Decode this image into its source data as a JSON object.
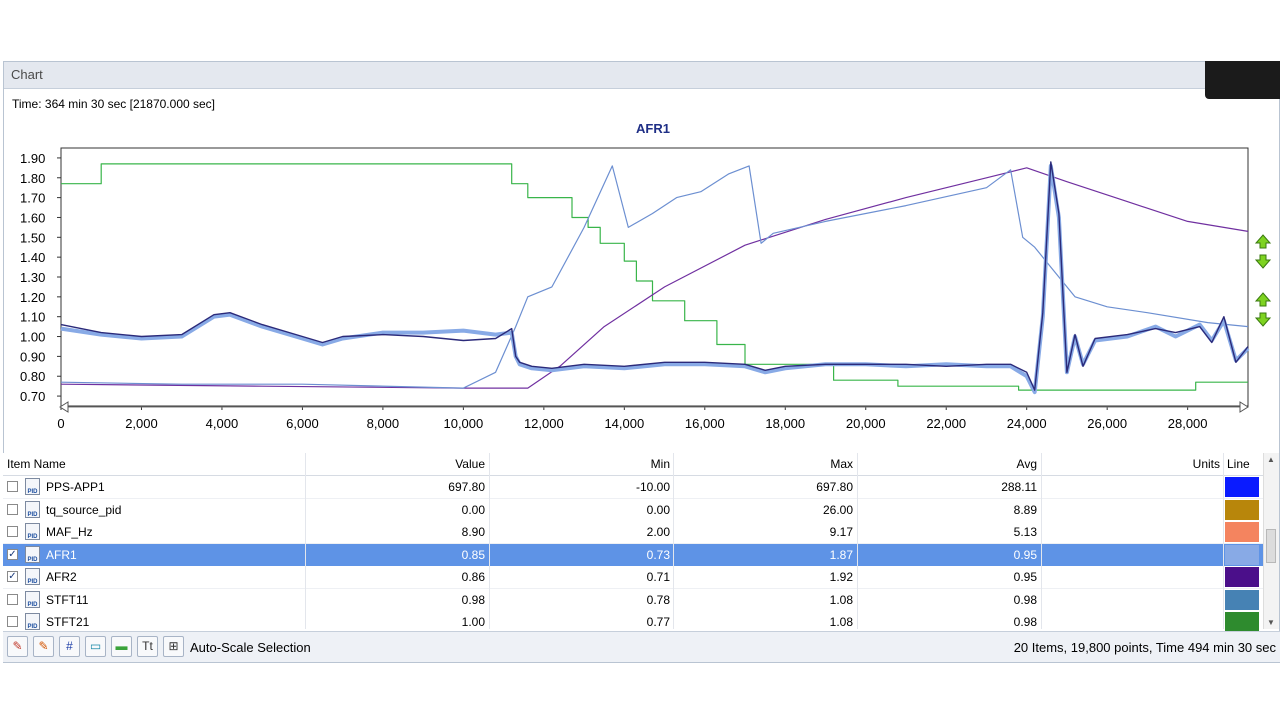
{
  "window": {
    "title": "Chart"
  },
  "time_label": "Time: 364 min 30 sec [21870.000 sec]",
  "chart_data": {
    "type": "line",
    "title": "AFR1",
    "xlim": [
      0,
      29500
    ],
    "ylim": [
      0.65,
      1.95
    ],
    "x_ticks": [
      0,
      2000,
      4000,
      6000,
      8000,
      10000,
      12000,
      14000,
      16000,
      18000,
      20000,
      22000,
      24000,
      26000,
      28000
    ],
    "x_tick_labels": [
      "0",
      "2,000",
      "4,000",
      "6,000",
      "8,000",
      "10,000",
      "12,000",
      "14,000",
      "16,000",
      "18,000",
      "20,000",
      "22,000",
      "24,000",
      "26,000",
      "28,000"
    ],
    "y_ticks": [
      0.7,
      0.8,
      0.9,
      1.0,
      1.1,
      1.2,
      1.3,
      1.4,
      1.5,
      1.6,
      1.7,
      1.8,
      1.9
    ],
    "y_tick_labels": [
      "0.70",
      "0.80",
      "0.90",
      "1.00",
      "1.10",
      "1.20",
      "1.30",
      "1.40",
      "1.50",
      "1.60",
      "1.70",
      "1.80",
      "1.90"
    ],
    "series": [
      {
        "color": "#39b54a",
        "width": 1.2,
        "step": true,
        "x": [
          0,
          1000,
          11200,
          11600,
          12700,
          13100,
          13400,
          14000,
          14300,
          14700,
          15500,
          16300,
          17000,
          19200,
          20800,
          23800,
          28000,
          28200,
          29500
        ],
        "y": [
          1.77,
          1.87,
          1.77,
          1.7,
          1.6,
          1.55,
          1.47,
          1.38,
          1.28,
          1.18,
          1.08,
          0.96,
          0.86,
          0.78,
          0.75,
          0.73,
          0.73,
          0.77,
          0.77
        ]
      },
      {
        "color": "#7030a0",
        "width": 1.2,
        "x": [
          0,
          5000,
          10000,
          11600,
          12400,
          13500,
          15000,
          17000,
          19000,
          21000,
          23000,
          24000,
          25000,
          26500,
          28000,
          29500
        ],
        "y": [
          0.76,
          0.75,
          0.74,
          0.74,
          0.85,
          1.05,
          1.25,
          1.46,
          1.59,
          1.7,
          1.8,
          1.85,
          1.78,
          1.68,
          1.58,
          1.53
        ]
      },
      {
        "color": "#6c8fd1",
        "width": 1.2,
        "x": [
          0,
          3000,
          6000,
          10000,
          10800,
          11300,
          11600,
          12200,
          13000,
          13700,
          14100,
          14700,
          15300,
          15900,
          16600,
          17100,
          17400,
          17700,
          19000,
          21000,
          23000,
          23600,
          23900,
          24200,
          24600,
          25200,
          26000,
          27000,
          28500,
          29500
        ],
        "y": [
          0.77,
          0.76,
          0.76,
          0.74,
          0.82,
          1.05,
          1.2,
          1.25,
          1.55,
          1.86,
          1.55,
          1.62,
          1.7,
          1.73,
          1.82,
          1.86,
          1.47,
          1.52,
          1.58,
          1.66,
          1.75,
          1.84,
          1.5,
          1.45,
          1.35,
          1.2,
          1.15,
          1.12,
          1.07,
          1.05
        ]
      },
      {
        "color": "#88aae6",
        "width": 4,
        "x": [
          0,
          1000,
          2000,
          3000,
          3800,
          4200,
          5000,
          6000,
          6500,
          7000,
          8000,
          9000,
          10000,
          10800,
          11200,
          11300,
          11400,
          11700,
          12200,
          13000,
          14000,
          15000,
          16000,
          17000,
          17500,
          18000,
          19000,
          20000,
          21000,
          22000,
          23000,
          23600,
          24000,
          24200,
          24400,
          24600,
          24800,
          25000,
          25200,
          25400,
          25700,
          26500,
          27200,
          27700,
          28300,
          28600,
          28900,
          29200,
          29500
        ],
        "y": [
          1.04,
          1.01,
          0.99,
          1.0,
          1.1,
          1.11,
          1.05,
          0.99,
          0.96,
          0.99,
          1.02,
          1.02,
          1.03,
          1.01,
          1.02,
          0.9,
          0.86,
          0.84,
          0.83,
          0.85,
          0.84,
          0.86,
          0.86,
          0.85,
          0.82,
          0.84,
          0.86,
          0.86,
          0.85,
          0.86,
          0.85,
          0.85,
          0.8,
          0.72,
          1.1,
          1.86,
          1.6,
          0.82,
          1.0,
          0.86,
          0.98,
          1.0,
          1.05,
          1.0,
          1.06,
          0.98,
          1.08,
          0.88,
          0.94
        ]
      },
      {
        "color": "#2b2a7a",
        "width": 1.4,
        "x": [
          0,
          1000,
          2000,
          3000,
          3800,
          4200,
          5000,
          6000,
          6500,
          7000,
          8000,
          9000,
          10000,
          10800,
          11200,
          11300,
          11400,
          11700,
          12200,
          13000,
          14000,
          15000,
          16000,
          17000,
          17500,
          18000,
          19000,
          20000,
          21000,
          22000,
          23000,
          23600,
          24000,
          24200,
          24400,
          24600,
          24800,
          25000,
          25200,
          25400,
          25700,
          26500,
          27200,
          27700,
          28300,
          28600,
          28900,
          29200,
          29500
        ],
        "y": [
          1.06,
          1.02,
          1.0,
          1.01,
          1.11,
          1.12,
          1.06,
          1.0,
          0.97,
          1.0,
          1.01,
          1.0,
          0.98,
          0.99,
          1.04,
          0.9,
          0.87,
          0.85,
          0.84,
          0.86,
          0.85,
          0.87,
          0.87,
          0.86,
          0.83,
          0.85,
          0.86,
          0.86,
          0.86,
          0.85,
          0.86,
          0.86,
          0.82,
          0.73,
          1.12,
          1.88,
          1.62,
          0.82,
          1.01,
          0.85,
          0.99,
          1.01,
          1.04,
          1.02,
          1.05,
          0.97,
          1.1,
          0.87,
          0.95
        ]
      }
    ]
  },
  "table": {
    "columns": {
      "item_name": "Item Name",
      "value": "Value",
      "min": "Min",
      "max": "Max",
      "avg": "Avg",
      "units": "Units",
      "line": "Line"
    },
    "pid_badge": "PID",
    "rows": [
      {
        "checked": false,
        "selected": false,
        "name": "PPS-APP1",
        "value": "697.80",
        "min": "-10.00",
        "max": "697.80",
        "avg": "288.11",
        "units": "",
        "color": "#0a1bff"
      },
      {
        "checked": false,
        "selected": false,
        "name": "tq_source_pid",
        "value": "0.00",
        "min": "0.00",
        "max": "26.00",
        "avg": "8.89",
        "units": "",
        "color": "#b8860b"
      },
      {
        "checked": false,
        "selected": false,
        "name": "MAF_Hz",
        "value": "8.90",
        "min": "2.00",
        "max": "9.17",
        "avg": "5.13",
        "units": "",
        "color": "#f4845f"
      },
      {
        "checked": true,
        "selected": true,
        "name": "AFR1",
        "value": "0.85",
        "min": "0.73",
        "max": "1.87",
        "avg": "0.95",
        "units": "",
        "color": "#88aae6"
      },
      {
        "checked": true,
        "selected": false,
        "name": "AFR2",
        "value": "0.86",
        "min": "0.71",
        "max": "1.92",
        "avg": "0.95",
        "units": "",
        "color": "#4b0f8a"
      },
      {
        "checked": false,
        "selected": false,
        "name": "STFT11",
        "value": "0.98",
        "min": "0.78",
        "max": "1.08",
        "avg": "0.98",
        "units": "",
        "color": "#4682b4"
      },
      {
        "checked": false,
        "selected": false,
        "name": "STFT21",
        "value": "1.00",
        "min": "0.77",
        "max": "1.08",
        "avg": "0.98",
        "units": "",
        "color": "#2e8b2e"
      }
    ]
  },
  "toolbar": {
    "buttons": [
      {
        "icon": "pencil-icon",
        "glyph": "✎",
        "color": "#c0392b"
      },
      {
        "icon": "pencil-edit-icon",
        "glyph": "✎",
        "color": "#d35400"
      },
      {
        "icon": "hash-icon",
        "glyph": "#",
        "color": "#1f3fa8"
      },
      {
        "icon": "tag-icon",
        "glyph": "▭",
        "color": "#1a8aa8"
      },
      {
        "icon": "line-icon",
        "glyph": "▬",
        "color": "#3aa33a"
      },
      {
        "icon": "text-icon",
        "glyph": "Tt",
        "color": "#333333"
      },
      {
        "icon": "chart-settings-icon",
        "glyph": "⊞",
        "color": "#333333"
      }
    ],
    "autoscale_label": "Auto-Scale Selection",
    "status": "20 Items, 19,800 points, Time 494 min 30 sec"
  }
}
